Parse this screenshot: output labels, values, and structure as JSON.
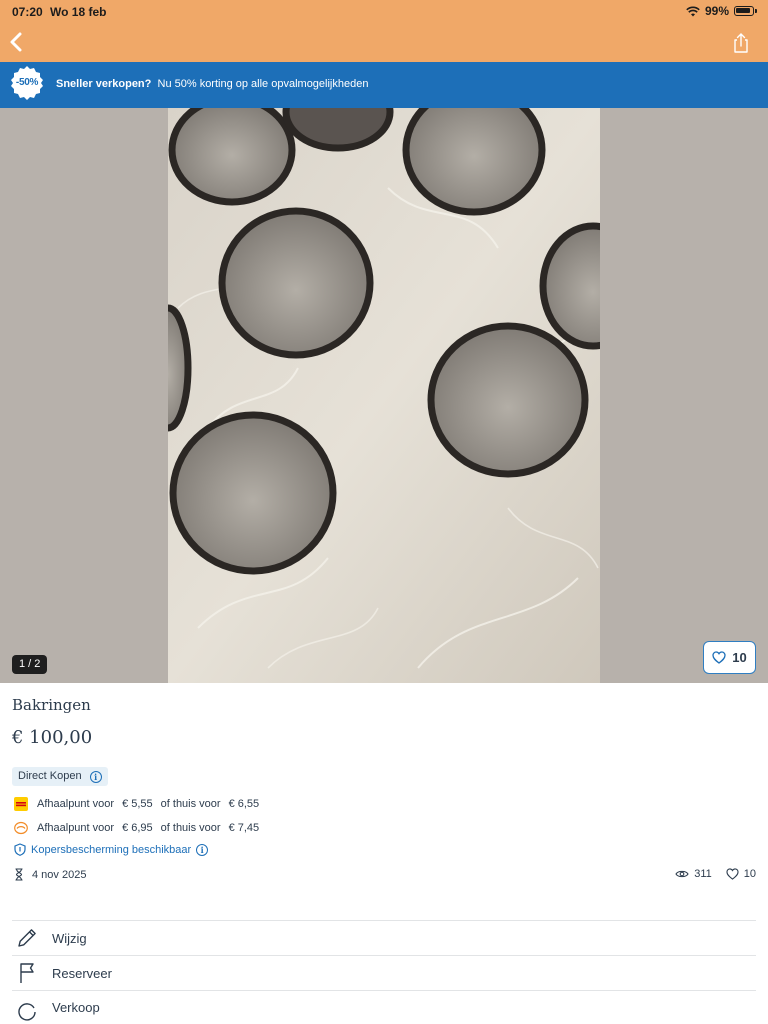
{
  "status_bar": {
    "time": "07:20",
    "date": "Wo 18 feb",
    "battery": "99%"
  },
  "nav": {
    "back_icon": "chevron-left-icon",
    "share_icon": "share-icon"
  },
  "promo": {
    "badge": "-50%",
    "lead": "Sneller verkopen?",
    "text": "Nu 50% korting op alle opvalmogelijkheden"
  },
  "gallery": {
    "counter": "1 / 2",
    "favorites": "10"
  },
  "listing": {
    "title": "Bakringen",
    "price": "€ 100,00",
    "direct_label": "Direct Kopen",
    "shipping": [
      {
        "carrier_icon": "dhl-logo-icon",
        "pickup": "Afhaalpunt voor",
        "pickup_price": "€ 5,55",
        "or": "of thuis voor",
        "home_price": "€ 6,55"
      },
      {
        "carrier_icon": "postnl-logo-icon",
        "pickup": "Afhaalpunt voor",
        "pickup_price": "€ 6,95",
        "or": "of thuis voor",
        "home_price": "€ 7,45"
      }
    ],
    "protection": "Kopersbescherming beschikbaar",
    "date": "4 nov 2025",
    "views": "311",
    "likes": "10"
  },
  "actions": [
    {
      "label": "Wijzig",
      "icon": "pencil-icon"
    },
    {
      "label": "Reserveer",
      "icon": "flag-icon"
    },
    {
      "label": "Verkoop",
      "icon": "refresh-icon"
    }
  ],
  "colors": {
    "header": "#f0a868",
    "promo": "#1d6fb8",
    "accent": "#2f7ec2"
  }
}
